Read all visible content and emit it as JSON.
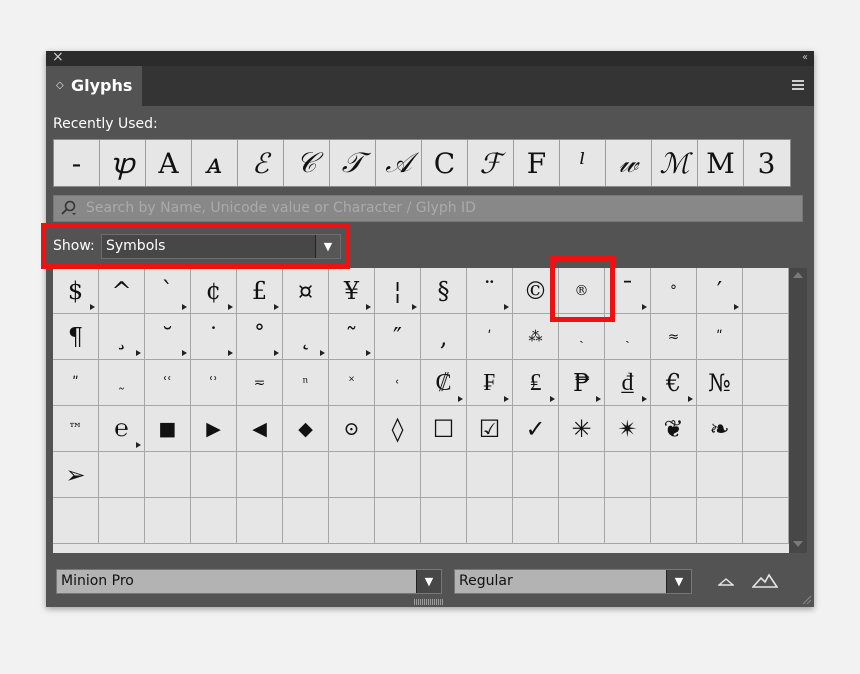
{
  "window": {
    "close_glyph": "×",
    "collapse_glyph": "‹‹"
  },
  "tab": {
    "label": "Glyphs",
    "arrow": "◇"
  },
  "recent": {
    "label": "Recently Used:",
    "glyphs": [
      "-",
      "ꝕ",
      "A",
      "ᴀ",
      "ℰ",
      "𝒞",
      "𝒯",
      "𝒜",
      "C",
      "ℱ",
      "F",
      "ˡ",
      "𝓌",
      "ℳ",
      "M",
      "3"
    ]
  },
  "search": {
    "placeholder": "Search by Name, Unicode value or Character / Glyph ID"
  },
  "show": {
    "label": "Show:",
    "value": "Symbols"
  },
  "glyph_grid": [
    [
      {
        "g": "$",
        "m": true
      },
      {
        "g": "^"
      },
      {
        "g": "`",
        "m": true
      },
      {
        "g": "¢",
        "m": true
      },
      {
        "g": "£",
        "m": true
      },
      {
        "g": "¤"
      },
      {
        "g": "¥",
        "m": true
      },
      {
        "g": "¦",
        "m": true
      },
      {
        "g": "§"
      },
      {
        "g": "¨",
        "m": true
      },
      {
        "g": "©"
      },
      {
        "g": "®",
        "s": "sm"
      },
      {
        "g": "¯",
        "m": true
      },
      {
        "g": "°",
        "s": "sm"
      },
      {
        "g": "′",
        "m": true
      },
      {
        "g": ""
      }
    ],
    [
      {
        "g": "¶"
      },
      {
        "g": "¸",
        "m": true
      },
      {
        "g": "˘",
        "m": true
      },
      {
        "g": "˙",
        "m": true
      },
      {
        "g": "˚",
        "m": true
      },
      {
        "g": "˛",
        "m": true
      },
      {
        "g": "˜",
        "m": true
      },
      {
        "g": "″"
      },
      {
        "g": "‚"
      },
      {
        "g": "ʹ",
        "s": "sm"
      },
      {
        "g": "⁂",
        "s": "sm"
      },
      {
        "g": "ˏ",
        "s": "sm"
      },
      {
        "g": "ˎ",
        "s": "sm"
      },
      {
        "g": "≈",
        "s": "sm"
      },
      {
        "g": "ʺ",
        "s": "sm"
      },
      {
        "g": ""
      }
    ],
    [
      {
        "g": "ʺ",
        "s": "sm"
      },
      {
        "g": "˷",
        "s": "sm"
      },
      {
        "g": "ʿʿ",
        "s": "sm"
      },
      {
        "g": "ʿʾ",
        "s": "sm"
      },
      {
        "g": "≂",
        "s": "sm"
      },
      {
        "g": "ⁿ",
        "s": "sm"
      },
      {
        "g": "˟",
        "s": "sm"
      },
      {
        "g": "˓",
        "s": "sm"
      },
      {
        "g": "₡",
        "m": true
      },
      {
        "g": "₣",
        "m": true
      },
      {
        "g": "₤",
        "m": true
      },
      {
        "g": "₱",
        "m": true
      },
      {
        "g": "₫",
        "m": true
      },
      {
        "g": "€",
        "m": true
      },
      {
        "g": "№"
      },
      {
        "g": ""
      }
    ],
    [
      {
        "g": "™",
        "s": "sm"
      },
      {
        "g": "℮",
        "m": true
      },
      {
        "g": "■",
        "s": "md"
      },
      {
        "g": "▶",
        "s": "md"
      },
      {
        "g": "◀",
        "s": "md"
      },
      {
        "g": "◆",
        "s": "md"
      },
      {
        "g": "⊙",
        "s": "md"
      },
      {
        "g": "◊"
      },
      {
        "g": "☐"
      },
      {
        "g": "☑"
      },
      {
        "g": "✓"
      },
      {
        "g": "✳"
      },
      {
        "g": "✴"
      },
      {
        "g": "❦"
      },
      {
        "g": "❧"
      },
      {
        "g": ""
      }
    ],
    [
      {
        "g": "➢"
      },
      {
        "g": ""
      },
      {
        "g": ""
      },
      {
        "g": ""
      },
      {
        "g": ""
      },
      {
        "g": ""
      },
      {
        "g": ""
      },
      {
        "g": ""
      },
      {
        "g": ""
      },
      {
        "g": ""
      },
      {
        "g": ""
      },
      {
        "g": ""
      },
      {
        "g": ""
      },
      {
        "g": ""
      },
      {
        "g": ""
      },
      {
        "g": ""
      }
    ],
    [
      {
        "g": ""
      },
      {
        "g": ""
      },
      {
        "g": ""
      },
      {
        "g": ""
      },
      {
        "g": ""
      },
      {
        "g": ""
      },
      {
        "g": ""
      },
      {
        "g": ""
      },
      {
        "g": ""
      },
      {
        "g": ""
      },
      {
        "g": ""
      },
      {
        "g": ""
      },
      {
        "g": ""
      },
      {
        "g": ""
      },
      {
        "g": ""
      },
      {
        "g": ""
      }
    ]
  ],
  "font": {
    "family": "Minion Pro",
    "style": "Regular",
    "dropdown_arrow": "▼"
  },
  "colors": {
    "highlight": "#ee1111",
    "panel": "#535353",
    "cell": "#e6e6e6"
  }
}
